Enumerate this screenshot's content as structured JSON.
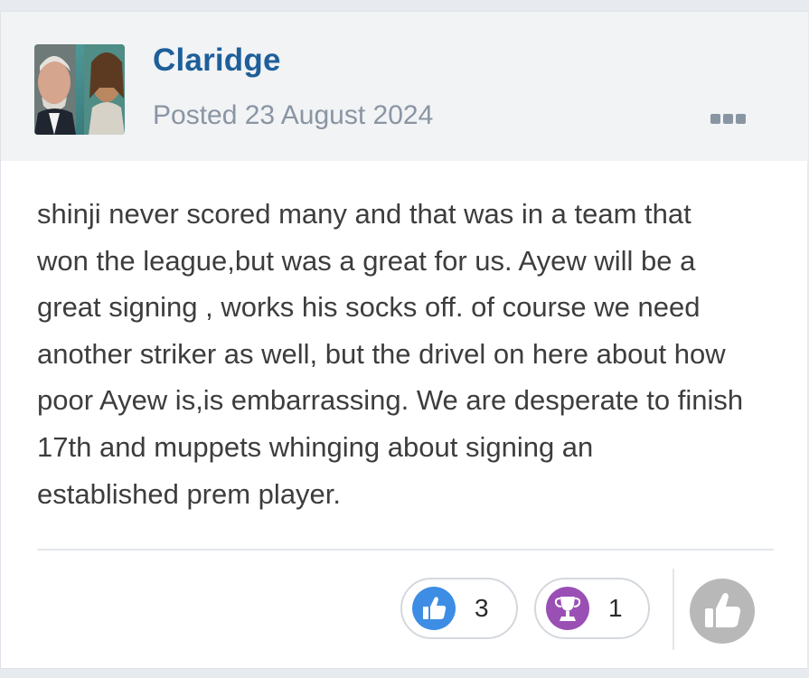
{
  "post": {
    "author": "Claridge",
    "posted": "Posted 23 August 2024",
    "body_lines": [
      "shinji never scored many and that was in a team that",
      "won the league,but was a great for us. Ayew will be a",
      "great signing , works his socks off. of course we need",
      "another striker as well, but the drivel on here about how",
      "poor Ayew is,is embarrassing. We are desperate to finish",
      "17th and muppets whinging about signing an",
      "established prem player."
    ]
  },
  "reactions": [
    {
      "icon": "thumbs-up-icon",
      "count": "3",
      "color": "#3d8de5"
    },
    {
      "icon": "trophy-icon",
      "count": "1",
      "color": "#9a4fb5"
    }
  ],
  "react_button": {
    "icon": "thumbs-up-icon",
    "color": "#b8b8b8"
  },
  "colors": {
    "author": "#1e5f9a",
    "header_bg": "#f1f3f5",
    "meta": "#8a95a3",
    "text": "#3d3d3d"
  }
}
